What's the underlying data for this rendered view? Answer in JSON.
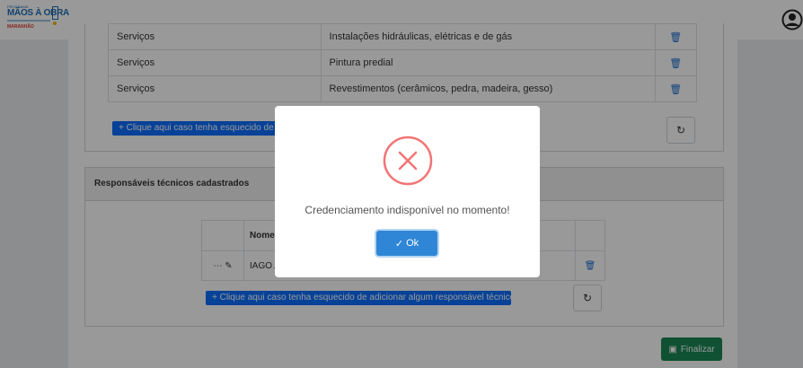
{
  "header": {
    "logo": {
      "line_small": "PROGRAMA",
      "line_main": "MÃOS À OBRA",
      "line_brand": "MARANHÃO"
    },
    "user_icon": "user-circle-icon"
  },
  "services": {
    "rows": [
      {
        "category": "Serviços",
        "description": "Instalações hidráulicas, elétricas e de gás"
      },
      {
        "category": "Serviços",
        "description": "Pintura predial"
      },
      {
        "category": "Serviços",
        "description": "Revestimentos (cerâmicos, pedra, madeira, gesso)"
      }
    ],
    "add_button_label": "+ Clique aqui caso tenha esquecido de adicionar algum serviço"
  },
  "technicians": {
    "title": "Responsáveis técnicos cadastrados",
    "column_header": "Nome",
    "rows": [
      {
        "name": "IAGO A"
      }
    ],
    "add_button_label": "+ Clique aqui caso tenha esquecido de adicionar algum responsável técnico"
  },
  "finalize_label": "Finalizar",
  "modal": {
    "message": "Credenciamento indisponível no momento!",
    "ok_label": "Ok"
  },
  "colors": {
    "primary": "#0d6efd",
    "success": "#198754",
    "error": "#f27474",
    "ok_button": "#2f86d6"
  },
  "icons": {
    "delete": "trash-icon",
    "refresh": "refresh-icon",
    "edit": "edit-icon",
    "more": "more-icon",
    "error": "error-circle-icon",
    "check": "check-icon",
    "save": "save-icon"
  }
}
